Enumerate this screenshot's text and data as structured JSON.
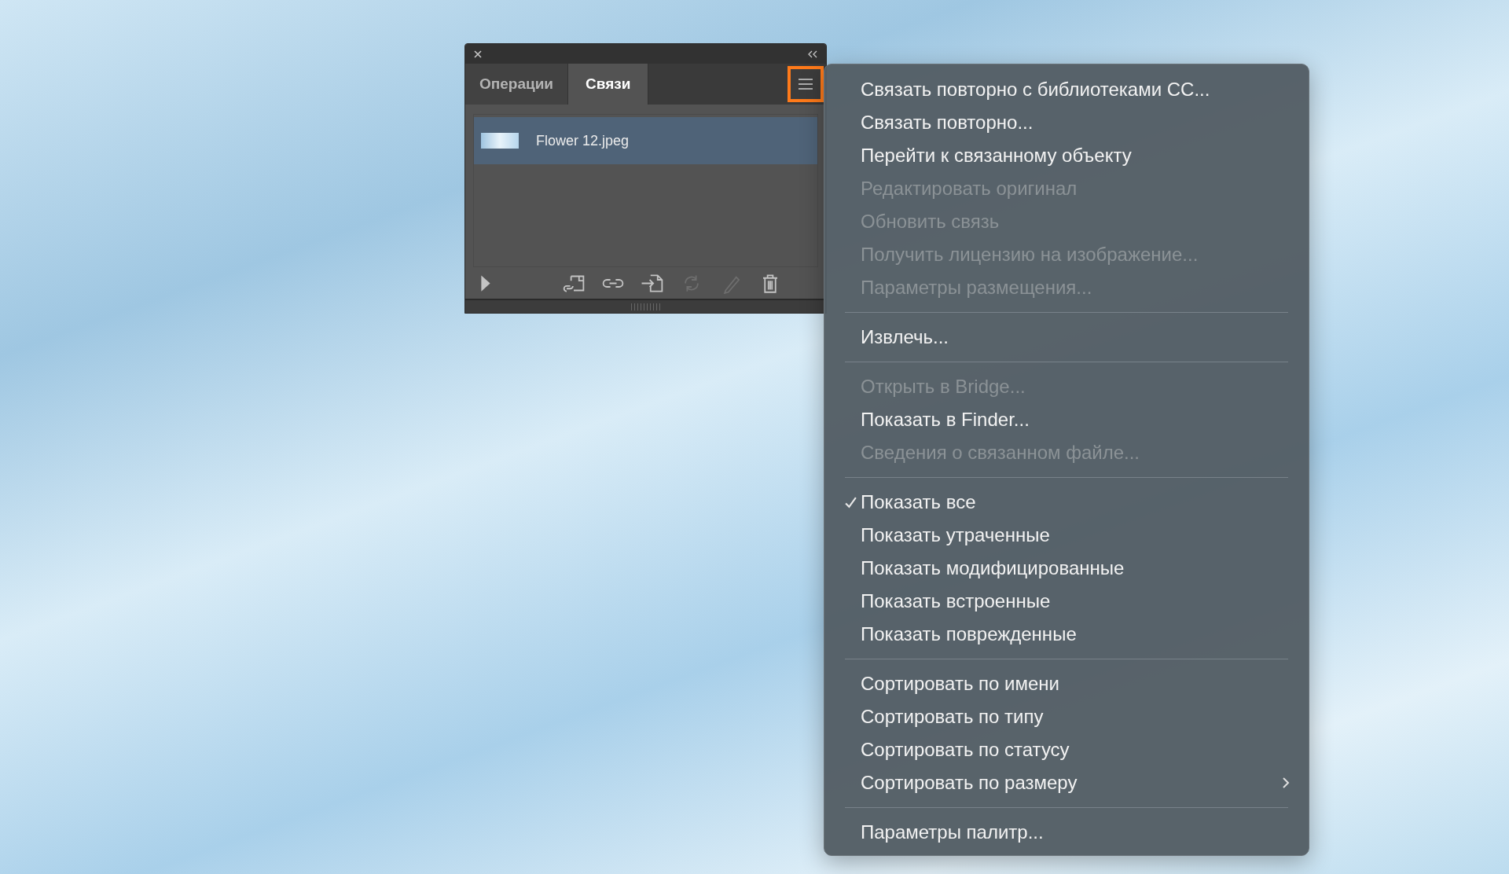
{
  "panel": {
    "tabs": [
      {
        "label": "Операции",
        "selected": false
      },
      {
        "label": "Связи",
        "selected": true
      }
    ],
    "menu_button": {
      "highlighted": true
    },
    "links": [
      {
        "name": "Flower 12.jpeg",
        "selected": true
      }
    ],
    "toolbar": [
      {
        "kind": "play",
        "disabled": false
      },
      {
        "kind": "relink-cc",
        "disabled": false
      },
      {
        "kind": "link",
        "disabled": false
      },
      {
        "kind": "goto",
        "disabled": false
      },
      {
        "kind": "update",
        "disabled": true
      },
      {
        "kind": "edit",
        "disabled": true
      },
      {
        "kind": "delete",
        "disabled": false
      }
    ]
  },
  "menu": {
    "groups": [
      {
        "items": [
          {
            "label": "Связать повторно с библиотеками CC...",
            "disabled": false,
            "checked": false,
            "submenu": false
          },
          {
            "label": "Связать повторно...",
            "disabled": false,
            "checked": false,
            "submenu": false
          },
          {
            "label": "Перейти к связанному объекту",
            "disabled": false,
            "checked": false,
            "submenu": false
          },
          {
            "label": "Редактировать оригинал",
            "disabled": true,
            "checked": false,
            "submenu": false
          },
          {
            "label": "Обновить связь",
            "disabled": true,
            "checked": false,
            "submenu": false
          },
          {
            "label": "Получить лицензию на изображение...",
            "disabled": true,
            "checked": false,
            "submenu": false
          },
          {
            "label": "Параметры размещения...",
            "disabled": true,
            "checked": false,
            "submenu": false
          }
        ]
      },
      {
        "items": [
          {
            "label": "Извлечь...",
            "disabled": false,
            "checked": false,
            "submenu": false
          }
        ]
      },
      {
        "items": [
          {
            "label": "Открыть в Bridge...",
            "disabled": true,
            "checked": false,
            "submenu": false
          },
          {
            "label": "Показать в Finder...",
            "disabled": false,
            "checked": false,
            "submenu": false
          },
          {
            "label": "Сведения о связанном файле...",
            "disabled": true,
            "checked": false,
            "submenu": false
          }
        ]
      },
      {
        "items": [
          {
            "label": "Показать все",
            "disabled": false,
            "checked": true,
            "submenu": false
          },
          {
            "label": "Показать утраченные",
            "disabled": false,
            "checked": false,
            "submenu": false
          },
          {
            "label": "Показать модифицированные",
            "disabled": false,
            "checked": false,
            "submenu": false
          },
          {
            "label": "Показать встроенные",
            "disabled": false,
            "checked": false,
            "submenu": false
          },
          {
            "label": "Показать поврежденные",
            "disabled": false,
            "checked": false,
            "submenu": false
          }
        ]
      },
      {
        "items": [
          {
            "label": "Сортировать по имени",
            "disabled": false,
            "checked": false,
            "submenu": false
          },
          {
            "label": "Сортировать по типу",
            "disabled": false,
            "checked": false,
            "submenu": false
          },
          {
            "label": "Сортировать по статусу",
            "disabled": false,
            "checked": false,
            "submenu": false
          },
          {
            "label": "Сортировать по размеру",
            "disabled": false,
            "checked": false,
            "submenu": true
          }
        ]
      },
      {
        "items": [
          {
            "label": "Параметры палитр...",
            "disabled": false,
            "checked": false,
            "submenu": false
          }
        ]
      }
    ]
  }
}
